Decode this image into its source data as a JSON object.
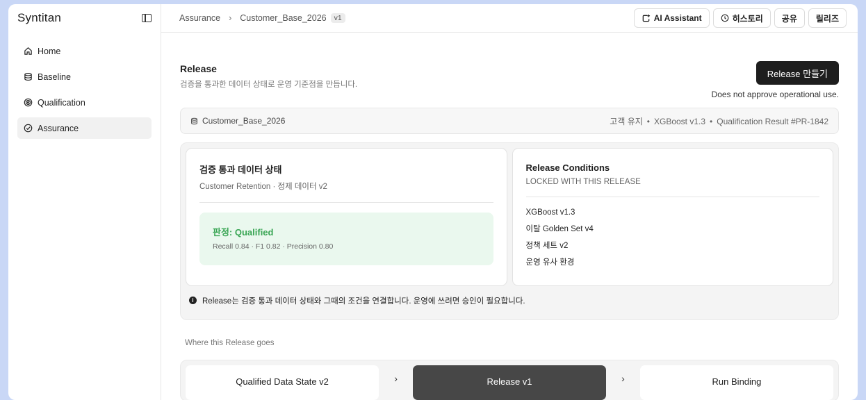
{
  "app": {
    "brand": "Syntitan"
  },
  "sidebar": {
    "items": [
      {
        "label": "Home",
        "icon": "home-icon"
      },
      {
        "label": "Baseline",
        "icon": "database-icon"
      },
      {
        "label": "Qualification",
        "icon": "target-icon"
      },
      {
        "label": "Assurance",
        "icon": "check-circle-icon",
        "active": true
      }
    ]
  },
  "header": {
    "breadcrumb": [
      "Assurance",
      "Customer_Base_2026"
    ],
    "version_badge": "v1",
    "actions": {
      "ai_assistant": "AI Assistant",
      "history": "히스토리",
      "share": "공유",
      "releases": "릴리즈"
    }
  },
  "page": {
    "title": "Release",
    "subtitle": "검증을 통과한 데이터 상태로 운영 기준점을 만듭니다.",
    "create_button": "Release 만들기",
    "approval_note": "Does not approve operational use."
  },
  "context": {
    "dataset": "Customer_Base_2026",
    "tags": [
      "고객 유지",
      "XGBoost v1.3",
      "Qualification Result #PR-1842"
    ],
    "separator": "•"
  },
  "state_card": {
    "title": "검증 통과 데이터 상태",
    "subtitle": "Customer Retention · 정제 데이터 v2",
    "verdict": "판정: Qualified",
    "metrics": "Recall 0.84 · F1 0.82 · Precision 0.80",
    "verdict_color": "#3aa655"
  },
  "conditions_card": {
    "title": "Release Conditions",
    "subtitle": "LOCKED WITH THIS RELEASE",
    "items": [
      "XGBoost v1.3",
      "이탈 Golden Set v4",
      "정책 세트 v2",
      "운영 유사 환경"
    ]
  },
  "info": "Release는 검증 통과 데이터 상태와 그때의 조건을 연결합니다. 운영에 쓰려면 승인이 필요합니다.",
  "where": {
    "label": "Where this Release goes",
    "steps": [
      "Qualified Data State v2",
      "Release v1",
      "Run Binding"
    ],
    "current_step": "Release v1",
    "arrow": "›"
  }
}
